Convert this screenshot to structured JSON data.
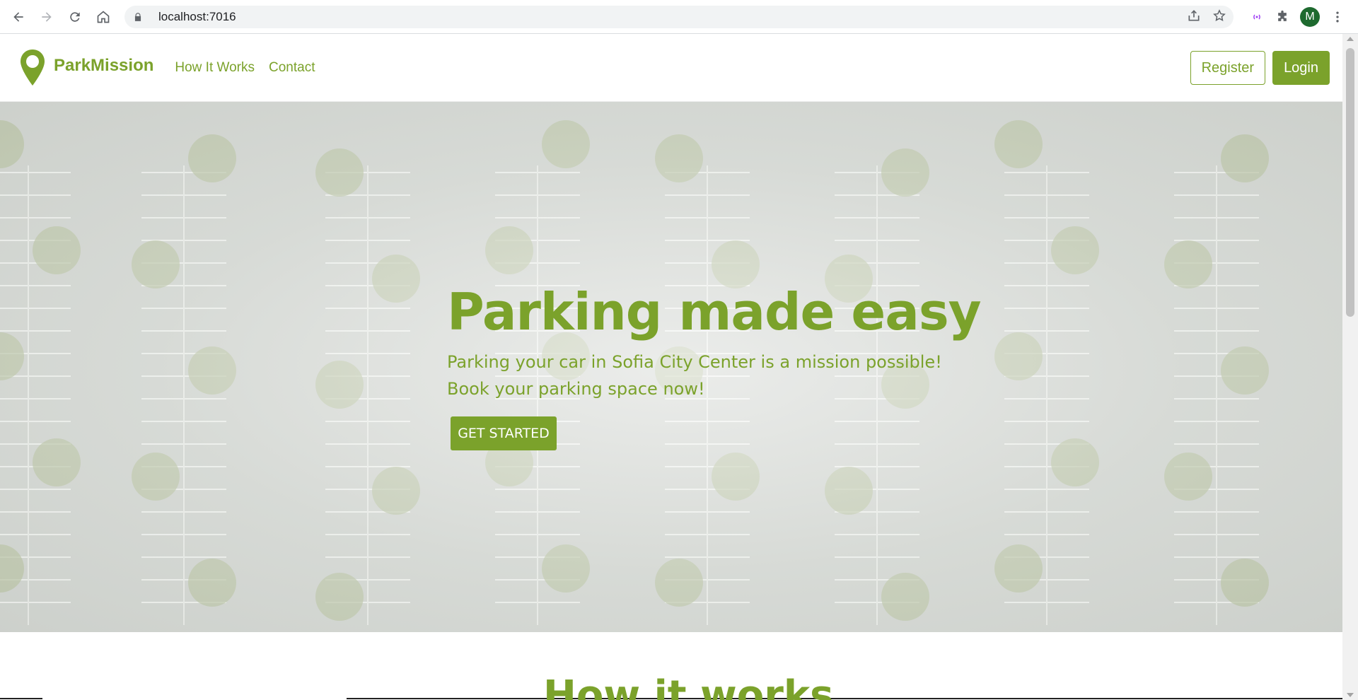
{
  "browser": {
    "url": "localhost:7016",
    "avatar_letter": "M",
    "icons": [
      "back-icon",
      "forward-icon",
      "reload-icon",
      "home-icon",
      "lock-icon",
      "share-icon",
      "star-icon",
      "media-icon",
      "extensions-icon",
      "menu-icon"
    ]
  },
  "header": {
    "brand": "ParkMission",
    "nav": [
      "How It Works",
      "Contact"
    ],
    "register_label": "Register",
    "login_label": "Login"
  },
  "hero": {
    "title": "Parking made easy",
    "subtitle_line1": "Parking your car in Sofia City Center is a mission possible!",
    "subtitle_line2": "Book your parking space now!",
    "cta_label": "GET STARTED"
  },
  "section": {
    "heading": "How it works"
  },
  "colors": {
    "accent": "#7ba22b",
    "avatar": "#1e6a2f"
  }
}
